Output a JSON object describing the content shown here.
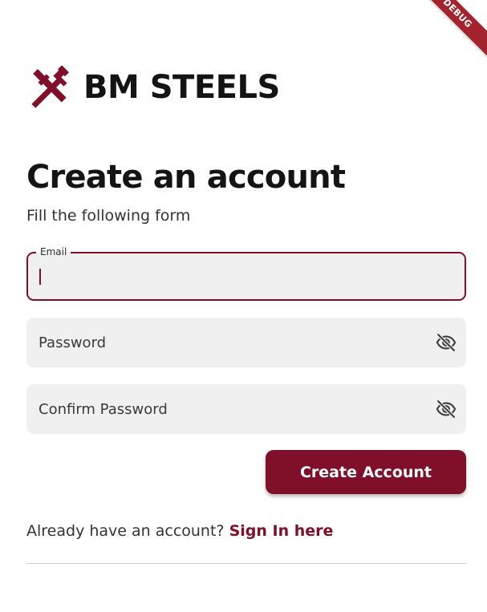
{
  "debug_banner": {
    "label": "DEBUG"
  },
  "brand": {
    "name": "BM STEELS",
    "icon": "crossed-hammers-icon"
  },
  "header": {
    "title": "Create an account",
    "subtitle": "Fill the following form"
  },
  "form": {
    "email": {
      "label": "Email",
      "value": ""
    },
    "password": {
      "placeholder": "Password",
      "value": "",
      "toggle_icon": "eye-slash-icon"
    },
    "confirm_password": {
      "placeholder": "Confirm Password",
      "value": "",
      "toggle_icon": "eye-slash-icon"
    },
    "submit_label": "Create Account"
  },
  "footer": {
    "prompt": "Already have an account? ",
    "link_label": "Sign In here"
  },
  "colors": {
    "accent": "#80102a",
    "field_fill": "#f0f0f0",
    "debug_ribbon": "#a3242e",
    "text": "#141414"
  }
}
